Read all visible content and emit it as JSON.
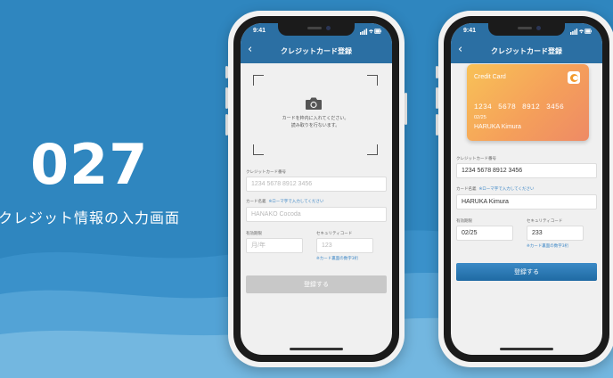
{
  "hero": {
    "number": "027",
    "subtitle": "クレジット情報の入力画面"
  },
  "colors": {
    "background": "#2f86bf",
    "nav_bar": "#2b6fa3",
    "accent": "#3b86c6",
    "button_disabled": "#c8c8c8",
    "card_gradient_start": "#f8c257",
    "card_gradient_end": "#ee8a65"
  },
  "phone_left": {
    "status_time": "9:41",
    "nav_title": "クレジットカード登録",
    "back_icon": "chevron-left-icon",
    "scanner": {
      "icon": "camera-icon",
      "text_line1": "カードを枠内に入れてください。",
      "text_line2": "読み取りを行ないます。"
    },
    "card_number": {
      "label": "クレジットカード番号",
      "placeholder": "1234 5678 8912 3456"
    },
    "card_name": {
      "label": "カード名義",
      "note": "※ローマ字で入力してください",
      "placeholder": "HANAKO Cocoda"
    },
    "expiry": {
      "label": "有効期限",
      "placeholder": "月/年"
    },
    "security": {
      "label": "セキュリティコード",
      "placeholder": "123",
      "hint": "※カード裏面の数字3桁"
    },
    "submit_label": "登録する"
  },
  "phone_right": {
    "status_time": "9:41",
    "nav_title": "クレジットカード登録",
    "back_icon": "chevron-left-icon",
    "card": {
      "title": "Credit Card",
      "number": "1234 5678 8912 3456",
      "expiry": "02/25",
      "holder": "HARUKA Kimura"
    },
    "card_number": {
      "label": "クレジットカード番号",
      "value": "1234 5678 8912 3456"
    },
    "card_name": {
      "label": "カード名義",
      "note": "※ローマ字で入力してください",
      "value": "HARUKA Kimura"
    },
    "expiry": {
      "label": "有効期限",
      "value": "02/25"
    },
    "security": {
      "label": "セキュリティコード",
      "value": "233",
      "hint": "※カード裏面の数字3桁"
    },
    "submit_label": "登録する"
  }
}
